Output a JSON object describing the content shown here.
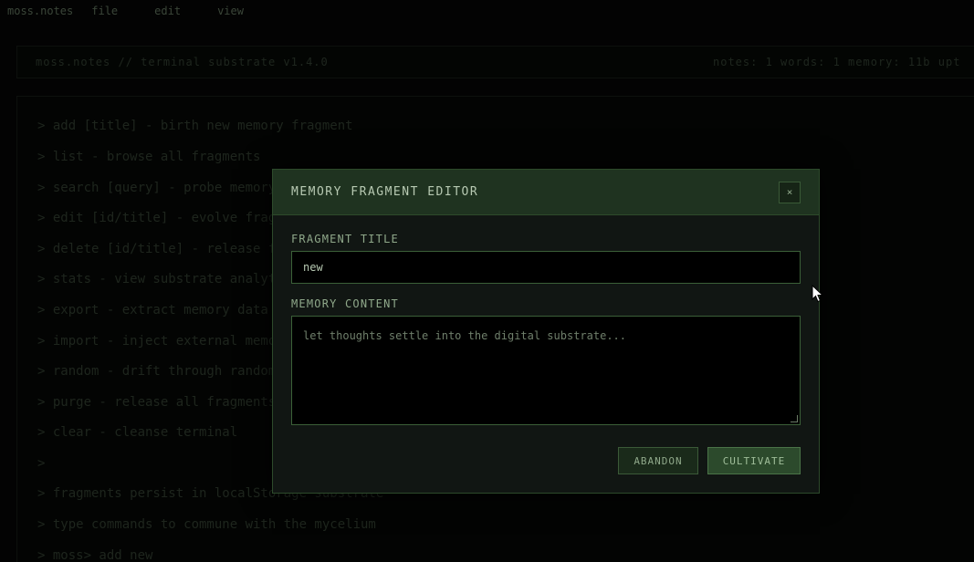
{
  "menubar": {
    "brand": "moss.notes",
    "items": [
      "file",
      "edit",
      "view"
    ]
  },
  "statusbar": {
    "title": "moss.notes // terminal substrate v1.4.0",
    "stats": "notes: 1   words: 1   memory: 11b   upt"
  },
  "terminal": {
    "lines": [
      "> add [title] - birth new memory fragment",
      "> list - browse all fragments",
      "> search [query] - probe memory",
      "> edit [id/title] - evolve fragment",
      "> delete [id/title] - release fragment",
      "> stats - view substrate analytics",
      "> export - extract memory data",
      "> import - inject external memory",
      "> random - drift through random fragment",
      "> purge - release all fragments",
      "> clear - cleanse terminal",
      ">",
      "> fragments persist in localStorage substrate",
      "> type commands to commune with the mycelium",
      "> moss> add new"
    ]
  },
  "modal": {
    "title": "MEMORY FRAGMENT EDITOR",
    "close_label": "×",
    "title_label": "FRAGMENT TITLE",
    "title_value": "new",
    "content_label": "MEMORY CONTENT",
    "content_placeholder": "let thoughts settle into the digital substrate...",
    "abandon_label": "ABANDON",
    "cultivate_label": "CULTIVATE"
  },
  "colors": {
    "accent": "#1f3320",
    "border": "#3b6038",
    "text": "#b7c9b2"
  }
}
